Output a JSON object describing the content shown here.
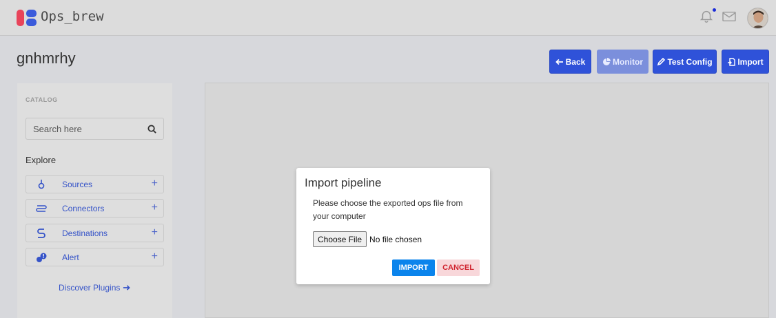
{
  "app": {
    "brand": "Ops_brew",
    "notification_icon": "bell-icon",
    "mail_icon": "mail-icon",
    "colors": {
      "primary": "#2f52d9",
      "brand_red": "#e8445a",
      "brand_blue": "#3b5bdb",
      "link": "#3553c8"
    }
  },
  "page": {
    "title": "gnhmrhy"
  },
  "actions": {
    "back": "Back",
    "monitor": "Monitor",
    "test_config": "Test Config",
    "import": "Import"
  },
  "sidebar": {
    "heading": "CATALOG",
    "search_placeholder": "Search here",
    "explore_label": "Explore",
    "items": [
      {
        "label": "Sources",
        "icon": "sources-icon"
      },
      {
        "label": "Connectors",
        "icon": "connectors-icon"
      },
      {
        "label": "Destinations",
        "icon": "destinations-icon"
      },
      {
        "label": "Alert",
        "icon": "alert-icon"
      }
    ],
    "discover_label": "Discover Plugins"
  },
  "modal": {
    "title": "Import pipeline",
    "message": "Please choose the exported ops file from your computer",
    "choose_file": "Choose File",
    "file_status": "No file chosen",
    "import_label": "IMPORT",
    "cancel_label": "CANCEL"
  }
}
